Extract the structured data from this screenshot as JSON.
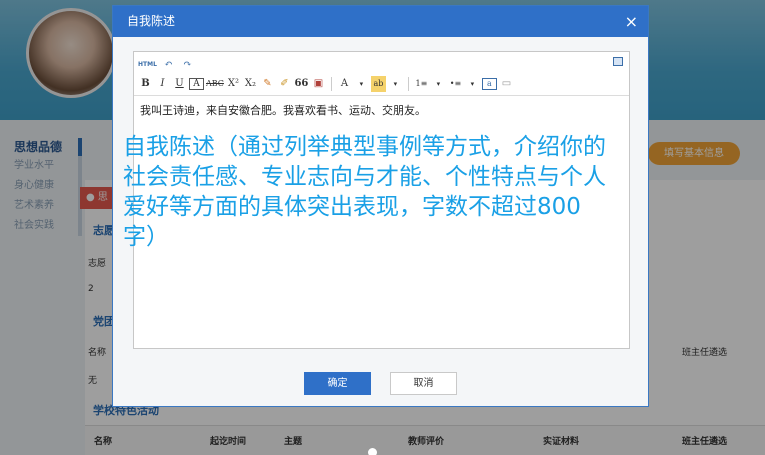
{
  "background": {
    "sidebar": {
      "title": "思想品德",
      "items": [
        "学业水平",
        "身心健康",
        "艺术素养",
        "社会实践"
      ]
    },
    "orange_button": "填写基本信息",
    "red_tag": "● 思",
    "rows": [
      {
        "text": "志愿"
      },
      {
        "text": "志愿"
      },
      {
        "text": "2"
      },
      {
        "text": "党团"
      },
      {
        "text": "名称"
      },
      {
        "text": "班主任遴选"
      },
      {
        "text": "无"
      },
      {
        "text": "学校特色活动"
      }
    ],
    "table_headers": [
      "名称",
      "起讫时间",
      "主题",
      "教师评价",
      "实证材料",
      "班主任遴选"
    ]
  },
  "dialog": {
    "title": "自我陈述",
    "close": "×",
    "toolbar": {
      "row1": [
        "HTML",
        "↶",
        "↷"
      ],
      "row2": [
        "B",
        "I",
        "U",
        "A",
        "ABC",
        "X²",
        "X₂",
        "✎",
        "✐",
        "66",
        "▣",
        "A",
        "ab",
        "1≡",
        "•≡",
        "a",
        "▭"
      ]
    },
    "editor_text": "我叫王诗迪，来自安徽合肥。我喜欢看书、运动、交朋友。",
    "placeholder": "自我陈述（通过列举典型事例等方式，介绍你的社会责任感、专业志向与才能、个性特点与个人爱好等方面的具体突出表现，字数不超过800字）",
    "ok_label": "确定",
    "cancel_label": "取消"
  }
}
